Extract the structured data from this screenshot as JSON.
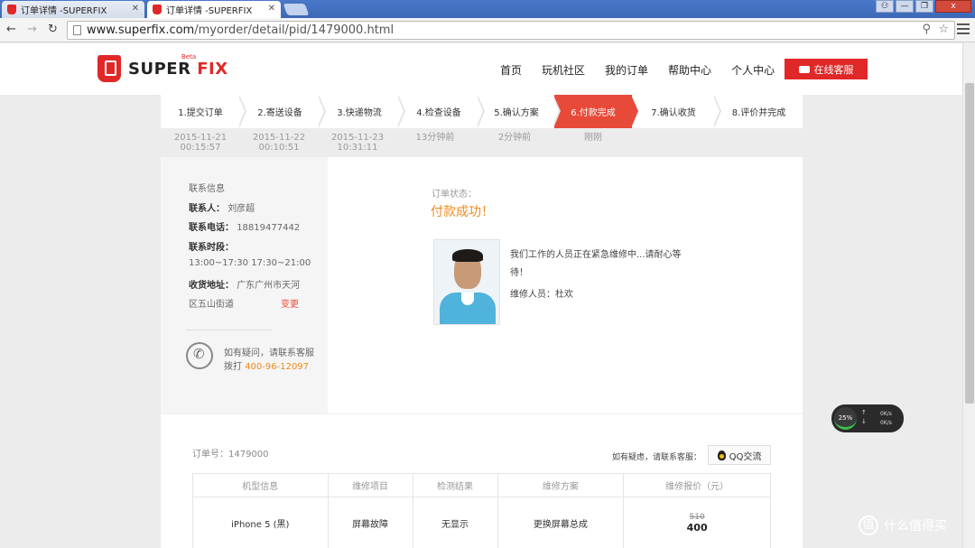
{
  "browser": {
    "tabs": [
      {
        "title": "订单详情 -SUPERFIX",
        "active": false
      },
      {
        "title": "订单详情 -SUPERFIX",
        "active": true
      }
    ],
    "url_host": "www.superfix.com",
    "url_path": "/myorder/detail/pid/1479000.html",
    "win_buttons": [
      "⚇",
      "—",
      "❐",
      "x"
    ]
  },
  "header": {
    "logo_super": "SUPER",
    "logo_fix": "FIX",
    "logo_beta": "Beta",
    "nav": [
      "首页",
      "玩机社区",
      "我的订单",
      "帮助中心",
      "个人中心"
    ],
    "service_button": "在线客服"
  },
  "steps": [
    {
      "label": "1.提交订单",
      "date": "2015-11-21",
      "time": "00:15:57"
    },
    {
      "label": "2.寄送设备",
      "date": "2015-11-22",
      "time": "00:10:51"
    },
    {
      "label": "3.快递物流",
      "date": "2015-11-23",
      "time": "10:31:11"
    },
    {
      "label": "4.检查设备",
      "date": "13分钟前",
      "time": ""
    },
    {
      "label": "5.确认方案",
      "date": "2分钟前",
      "time": ""
    },
    {
      "label": "6.付款完成",
      "date": "刚刚",
      "time": "",
      "active": true
    },
    {
      "label": "7.确认收货",
      "date": "",
      "time": ""
    },
    {
      "label": "8.评价并完成",
      "date": "",
      "time": ""
    }
  ],
  "contact": {
    "title": "联系信息",
    "person_label": "联系人：",
    "person": "刘彦超",
    "phone_label": "联系电话：",
    "phone": "18819477442",
    "time_label": "联系时段：",
    "time": "13:00~17:30 17:30~21:00",
    "address_label": "收货地址：",
    "address_line1": "广东广州市天河",
    "address_line2": "区五山街道",
    "change": "变更",
    "help_line1": "如有疑问，请联系客服",
    "help_dial": "拨打",
    "help_phone": "400-96-12097"
  },
  "status": {
    "label": "订单状态：",
    "value": "付款成功！",
    "message_line1": "我们工作的人员正在紧急维修中...请耐心等",
    "message_line2": "待！",
    "worker": "维修人员：杜欢"
  },
  "order": {
    "number": "订单号：1479000",
    "question": "如有疑虑，请联系客服：",
    "qq_button": "QQ交流",
    "columns": [
      "机型信息",
      "维修项目",
      "检测结果",
      "维修方案",
      "维修报价（元）"
    ],
    "row": {
      "model": "iPhone 5 (黑)",
      "item": "屏幕故障",
      "result": "无显示",
      "plan": "更换屏幕总成",
      "price_old": "510",
      "price_new": "400"
    }
  },
  "netwidget": {
    "percent": "25%",
    "up": "0K/s",
    "down": "0K/s"
  },
  "watermark": {
    "glyph": "值",
    "text": "什么值得买"
  }
}
